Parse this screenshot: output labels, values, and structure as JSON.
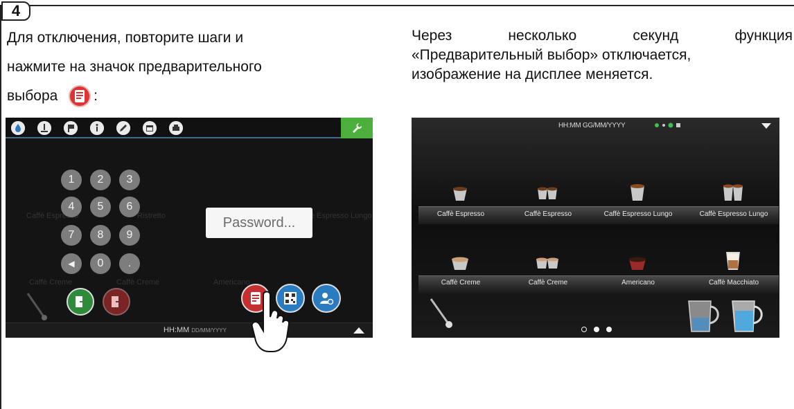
{
  "step": {
    "number": "4"
  },
  "left": {
    "line1": "Для отключения, повторите шаги и",
    "line2": "нажмите на значок предварительного",
    "line3": "выбора",
    "line3_suffix": ":",
    "inline_icon": "preselection-icon"
  },
  "right": {
    "w1": "Через",
    "w2": "несколько",
    "w3": "секунд",
    "w4": "функция",
    "line2": "«Предварительный выбор» отключается,",
    "line3": "изображение на дисплее меняется."
  },
  "left_screen": {
    "topbar_icons": [
      "water-drop-icon",
      "thermometer-icon",
      "flag-icon",
      "info-icon",
      "pencil-icon",
      "calendar-icon",
      "printer-icon"
    ],
    "wrench_icon": "wrench-icon",
    "keypad": [
      "1",
      "2",
      "3",
      "4",
      "5",
      "6",
      "7",
      "8",
      "9",
      "◀",
      "0",
      "."
    ],
    "password_placeholder": "Password...",
    "background_labels": [
      "Caffè Espresso",
      "Caffè Espresso",
      "Caffè Creme",
      "Americano",
      "Caffè Macchiato",
      "Caffè Espresso Lungo"
    ],
    "status_time": "HH:MM",
    "status_date": "DD/MM/YYYY",
    "accent_green": "#4caf3c",
    "accent_red": "#c42f2f",
    "accent_blue": "#2a7cc0"
  },
  "right_screen": {
    "status_time": "HH:MM GG/MM/YYYY",
    "row1": [
      "Caffè Espresso",
      "Caffè Espresso",
      "Caffè Espresso Lungo",
      "Caffè Espresso Lungo"
    ],
    "row2": [
      "Caffè Creme",
      "Caffè Creme",
      "Americano",
      "Caffè Macchiato"
    ],
    "page_dots": 3,
    "active_dot": 0
  }
}
